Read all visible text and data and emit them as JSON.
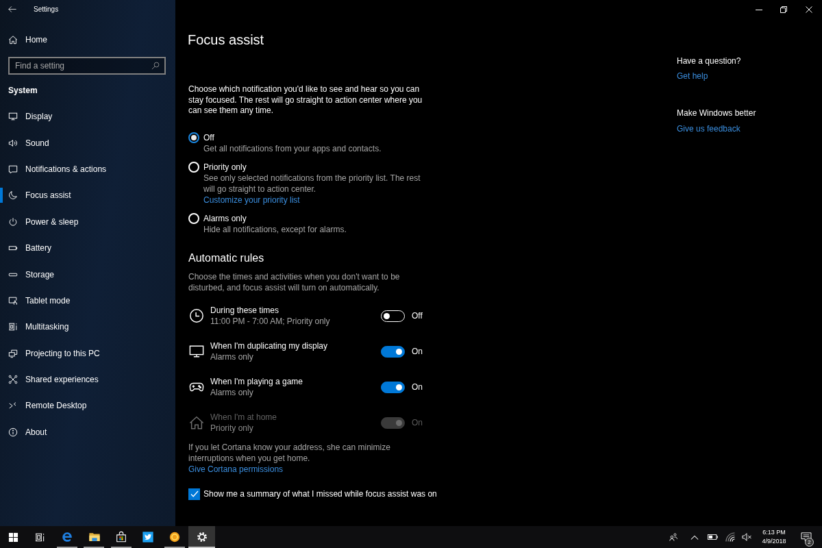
{
  "window": {
    "title": "Settings"
  },
  "sidebar": {
    "home": "Home",
    "search": {
      "placeholder": "Find a setting"
    },
    "section": "System",
    "items": [
      {
        "label": "Display",
        "selected": false
      },
      {
        "label": "Sound",
        "selected": false
      },
      {
        "label": "Notifications & actions",
        "selected": false
      },
      {
        "label": "Focus assist",
        "selected": true
      },
      {
        "label": "Power & sleep",
        "selected": false
      },
      {
        "label": "Battery",
        "selected": false
      },
      {
        "label": "Storage",
        "selected": false
      },
      {
        "label": "Tablet mode",
        "selected": false
      },
      {
        "label": "Multitasking",
        "selected": false
      },
      {
        "label": "Projecting to this PC",
        "selected": false
      },
      {
        "label": "Shared experiences",
        "selected": false
      },
      {
        "label": "Remote Desktop",
        "selected": false
      },
      {
        "label": "About",
        "selected": false
      }
    ]
  },
  "page": {
    "title": "Focus assist",
    "intro": "Choose which notification you'd like to see and hear so you can stay focused. The rest will go straight to action center where you can see them any time.",
    "options": [
      {
        "label": "Off",
        "description": "Get all notifications from your apps and contacts.",
        "selected": true
      },
      {
        "label": "Priority only",
        "description": "See only selected notifications from the priority list. The rest will go straight to action center.",
        "link": "Customize your priority list",
        "selected": false
      },
      {
        "label": "Alarms only",
        "description": "Hide all notifications, except for alarms.",
        "selected": false
      }
    ],
    "rules_heading": "Automatic rules",
    "rules_intro": "Choose the times and activities when you don't want to be disturbed, and focus assist will turn on automatically.",
    "rules": [
      {
        "title": "During these times",
        "subtitle": "11:00 PM - 7:00 AM; Priority only",
        "on": false,
        "state": "Off",
        "disabled": false
      },
      {
        "title": "When I'm duplicating my display",
        "subtitle": "Alarms only",
        "on": true,
        "state": "On",
        "disabled": false
      },
      {
        "title": "When I'm playing a game",
        "subtitle": "Alarms only",
        "on": true,
        "state": "On",
        "disabled": false
      },
      {
        "title": "When I'm at home",
        "subtitle": "Priority only",
        "on": true,
        "state": "On",
        "disabled": true
      }
    ],
    "cortana_note": "If you let Cortana know your address, she can minimize interruptions when you get home.",
    "cortana_link": "Give Cortana permissions",
    "summary": {
      "label": "Show me a summary of what I missed while focus assist was on",
      "checked": true
    }
  },
  "help": {
    "question": "Have a question?",
    "help_link": "Get help",
    "feedback_heading": "Make Windows better",
    "feedback_link": "Give us feedback"
  },
  "taskbar": {
    "apps": [
      {
        "running": true,
        "selected": false
      },
      {
        "running": true,
        "selected": false
      },
      {
        "running": true,
        "selected": false
      },
      {
        "running": false,
        "selected": false
      },
      {
        "running": true,
        "selected": false
      },
      {
        "running": true,
        "selected": true
      }
    ],
    "clock": {
      "time": "6:13 PM",
      "date": "4/9/2018"
    },
    "notifications": "2"
  }
}
